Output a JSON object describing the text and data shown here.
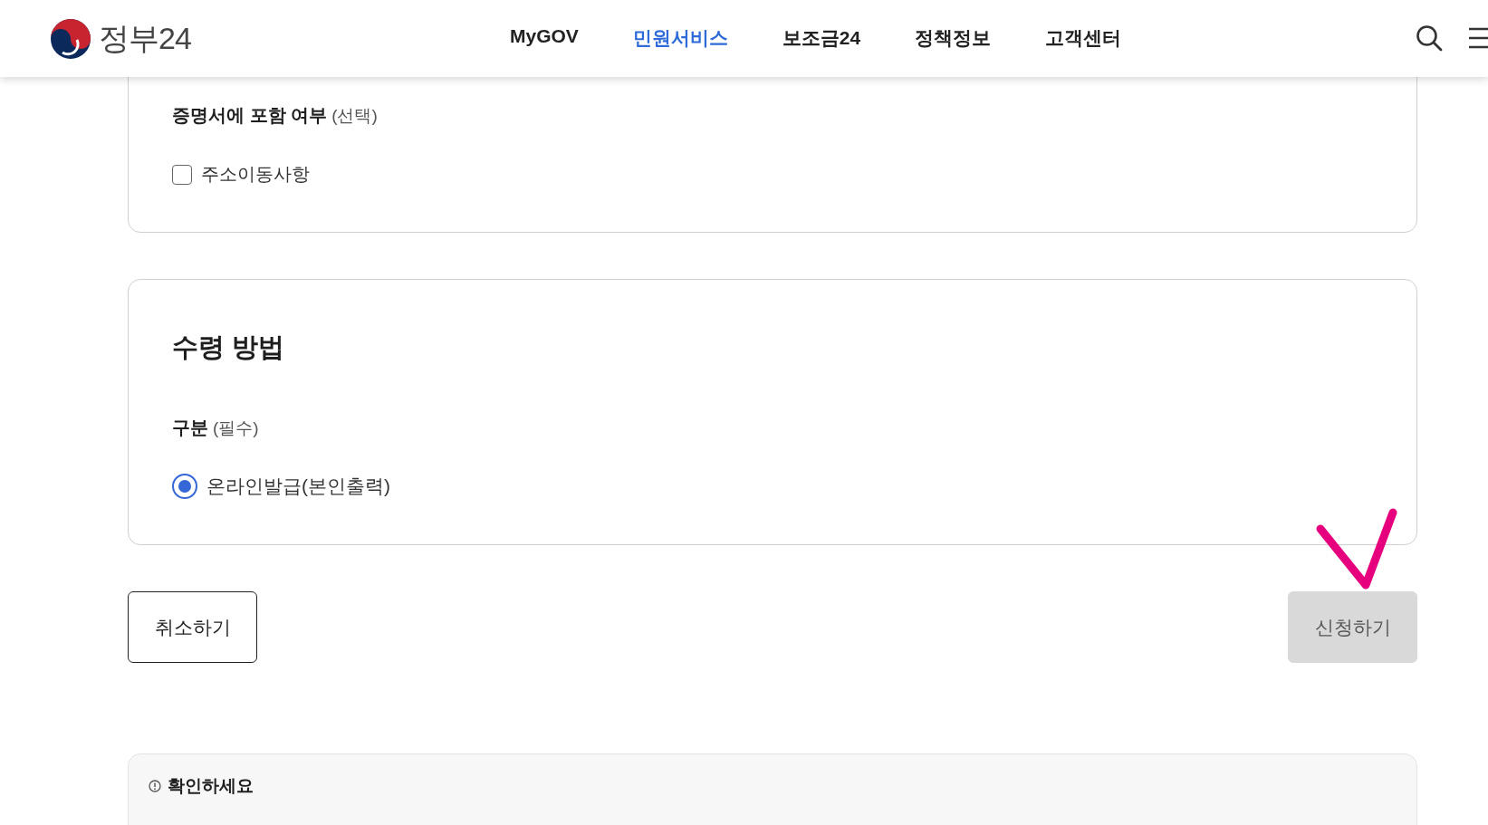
{
  "header": {
    "logo": "정부24",
    "nav": [
      {
        "label": "MyGOV",
        "selected": false
      },
      {
        "label": "민원서비스",
        "selected": true
      },
      {
        "label": "보조금24",
        "selected": false
      },
      {
        "label": "정책정보",
        "selected": false
      },
      {
        "label": "고객센터",
        "selected": false
      }
    ]
  },
  "sections": [
    {
      "kind": "checkbox-group",
      "label": "증명서에 포함 여부",
      "hint": "(선택)",
      "options": [
        {
          "label": "주소이동사항",
          "checked": false
        }
      ]
    },
    {
      "kind": "radio-group",
      "title": "수령 방법",
      "label": "구분",
      "hint": "(필수)",
      "options": [
        {
          "label": "온라인발급(본인출력)",
          "selected": true
        }
      ]
    }
  ],
  "buttons": [
    {
      "label": "취소하기",
      "disabled": false
    },
    {
      "label": "신청하기",
      "disabled": true
    }
  ],
  "notice": {
    "title": "확인하세요"
  }
}
